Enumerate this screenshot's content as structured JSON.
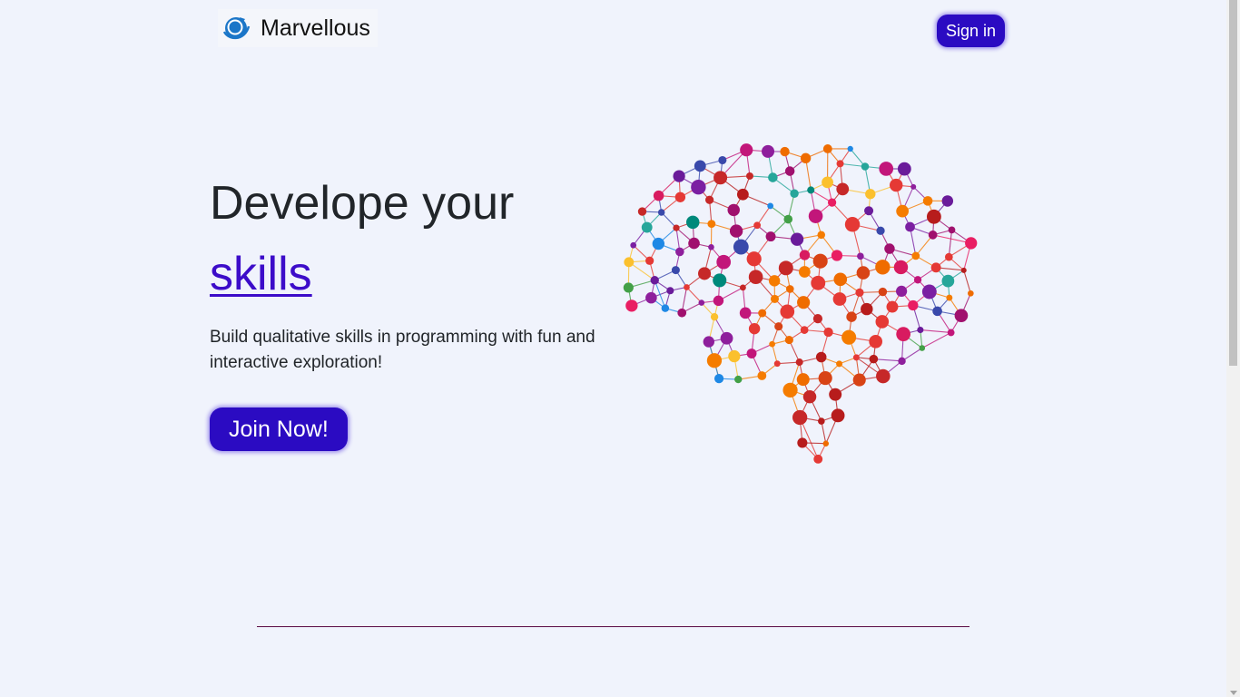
{
  "navbar": {
    "logo_icon": "globe-orbit-icon",
    "brand_name": "Marvellous",
    "signin_label": "Sign in"
  },
  "hero": {
    "heading_line1": "Develope your",
    "heading_link": "skills",
    "description": "Build qualitative skills in programming with fun and interactive exploration!",
    "join_label": "Join Now!"
  },
  "illustration": {
    "icon": "colorful-brain-network-icon"
  },
  "colors": {
    "background": "#f0f3fc",
    "button": "#2b0bc2",
    "link": "#3c0cc9",
    "divider": "#5a0b45"
  }
}
